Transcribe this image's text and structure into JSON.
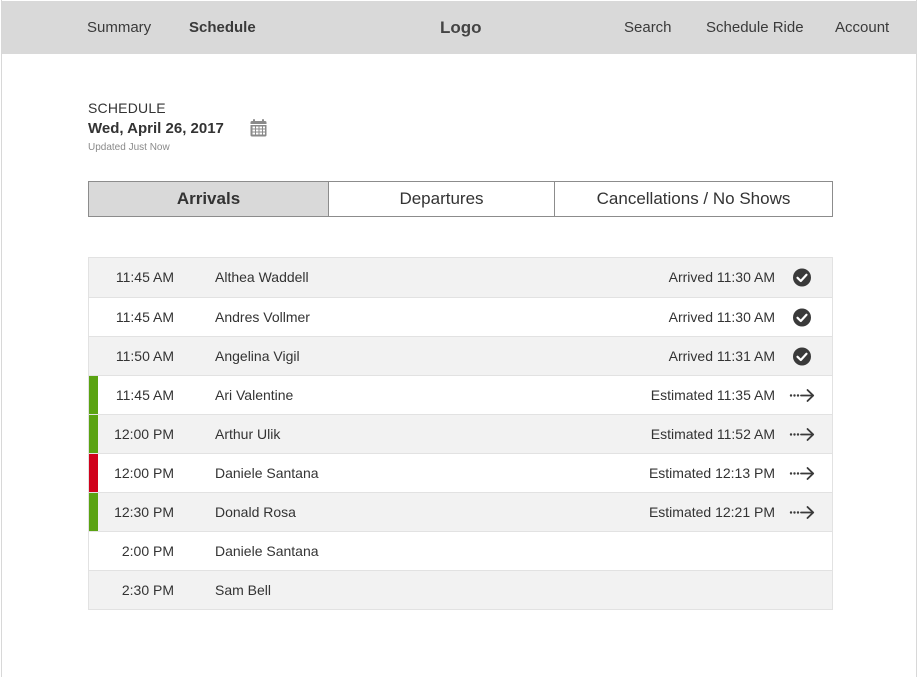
{
  "nav": {
    "summary": "Summary",
    "schedule": "Schedule",
    "logo": "Logo",
    "search": "Search",
    "schedule_ride": "Schedule Ride",
    "account": "Account"
  },
  "header": {
    "section_label": "SCHEDULE",
    "date": "Wed, April 26, 2017",
    "updated": "Updated Just Now",
    "calendar_icon": "calendar-icon"
  },
  "tabs": [
    {
      "label": "Arrivals",
      "active": true
    },
    {
      "label": "Departures",
      "active": false
    },
    {
      "label": "Cancellations / No Shows",
      "active": false
    }
  ],
  "colors": {
    "on_time": "#5aa312",
    "late": "#d0021b",
    "nav_bg": "#d9d9d9",
    "row_shade": "#f2f2f2"
  },
  "rows": [
    {
      "time": "11:45 AM",
      "name": "Althea Waddell",
      "status": "Arrived 11:30 AM",
      "icon": "check-circle-icon",
      "indicator": "none"
    },
    {
      "time": "11:45 AM",
      "name": "Andres Vollmer",
      "status": "Arrived 11:30 AM",
      "icon": "check-circle-icon",
      "indicator": "none"
    },
    {
      "time": "11:50 AM",
      "name": "Angelina Vigil",
      "status": "Arrived 11:31 AM",
      "icon": "check-circle-icon",
      "indicator": "none"
    },
    {
      "time": "11:45 AM",
      "name": "Ari Valentine",
      "status": "Estimated 11:35 AM",
      "icon": "en-route-arrow-icon",
      "indicator": "on_time"
    },
    {
      "time": "12:00 PM",
      "name": "Arthur Ulik",
      "status": "Estimated 11:52 AM",
      "icon": "en-route-arrow-icon",
      "indicator": "on_time"
    },
    {
      "time": "12:00 PM",
      "name": "Daniele Santana",
      "status": "Estimated 12:13 PM",
      "icon": "en-route-arrow-icon",
      "indicator": "late"
    },
    {
      "time": "12:30 PM",
      "name": "Donald Rosa",
      "status": "Estimated 12:21 PM",
      "icon": "en-route-arrow-icon",
      "indicator": "on_time"
    },
    {
      "time": "2:00 PM",
      "name": "Daniele Santana",
      "status": "",
      "icon": "",
      "indicator": "none"
    },
    {
      "time": "2:30 PM",
      "name": "Sam Bell",
      "status": "",
      "icon": "",
      "indicator": "none"
    }
  ]
}
